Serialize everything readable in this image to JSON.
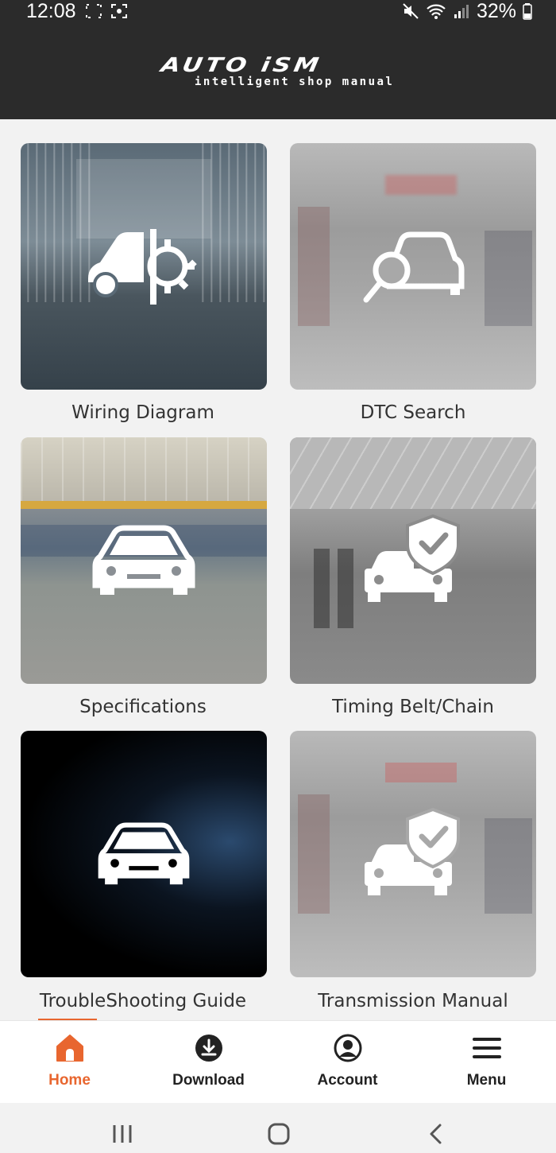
{
  "status_bar": {
    "time": "12:08",
    "battery": "32%"
  },
  "app": {
    "brand": "AUTO iSM",
    "tagline": "intelligent shop manual"
  },
  "tiles": [
    {
      "label": "Wiring Diagram",
      "icon": "car-gear-icon"
    },
    {
      "label": "DTC Search",
      "icon": "car-search-icon"
    },
    {
      "label": "Specifications",
      "icon": "car-front-icon"
    },
    {
      "label": "Timing Belt/Chain",
      "icon": "car-shield-icon"
    },
    {
      "label": "TroubleShooting Guide",
      "icon": "car-front-icon"
    },
    {
      "label": "Transmission Manual",
      "icon": "car-shield-icon"
    }
  ],
  "bottom_nav": [
    {
      "label": "Home",
      "icon": "home-icon",
      "active": true
    },
    {
      "label": "Download",
      "icon": "download-icon",
      "active": false
    },
    {
      "label": "Account",
      "icon": "account-icon",
      "active": false
    },
    {
      "label": "Menu",
      "icon": "menu-icon",
      "active": false
    }
  ],
  "colors": {
    "accent": "#e8662f",
    "header": "#2b2b2b"
  }
}
